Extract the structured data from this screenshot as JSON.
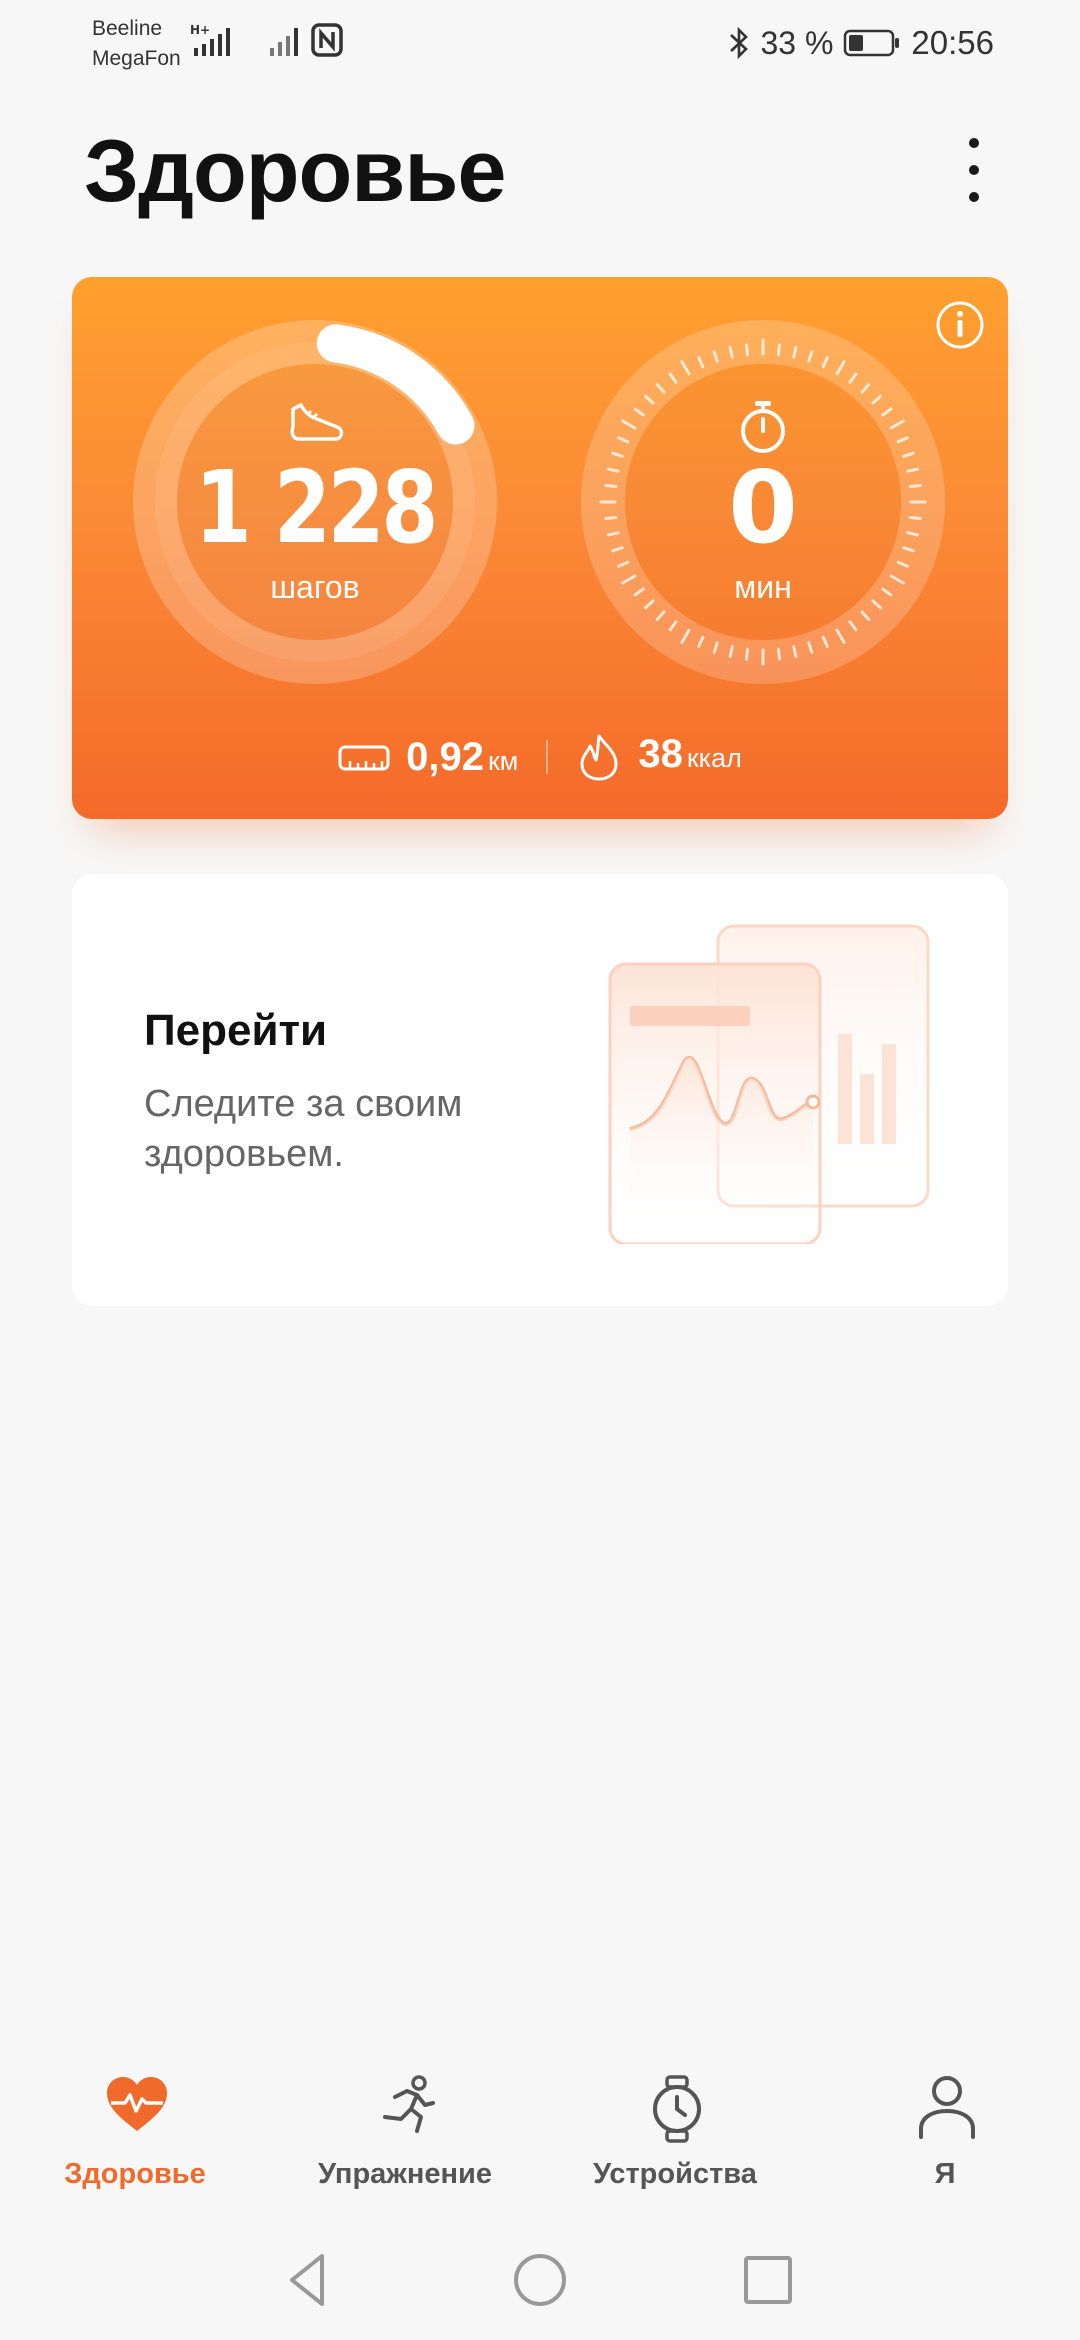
{
  "status_bar": {
    "carrier_1": "Beeline",
    "carrier_2": "MegaFon",
    "network_type": "H+",
    "battery_percent": "33 %",
    "time": "20:56",
    "icons": [
      "signal-icon",
      "nfc-icon",
      "bluetooth-icon",
      "battery-icon"
    ]
  },
  "header": {
    "title": "Здоровье",
    "more_icon": "more-vertical-icon"
  },
  "activity": {
    "steps_value": "1 228",
    "steps_unit": "шагов",
    "steps_goal_progress": 0.15,
    "time_value": "0",
    "time_unit": "мин",
    "distance_value": "0,92",
    "distance_unit": "км",
    "calories_value": "38",
    "calories_unit": "ккал",
    "colors": {
      "gradient_top": "#ffa02f",
      "gradient_bottom": "#f46a2a"
    }
  },
  "promo": {
    "title": "Перейти",
    "description": "Следите за своим здоровьем."
  },
  "bottom_nav": {
    "active_color": "#ef6a2b",
    "items": [
      {
        "label": "Здоровье",
        "icon": "heart-pulse-icon",
        "active": true
      },
      {
        "label": "Упражнение",
        "icon": "running-icon",
        "active": false
      },
      {
        "label": "Устройства",
        "icon": "watch-icon",
        "active": false
      },
      {
        "label": "Я",
        "icon": "person-icon",
        "active": false
      }
    ]
  },
  "system_nav": {
    "icons": [
      "back-icon",
      "home-icon",
      "recents-icon"
    ]
  }
}
